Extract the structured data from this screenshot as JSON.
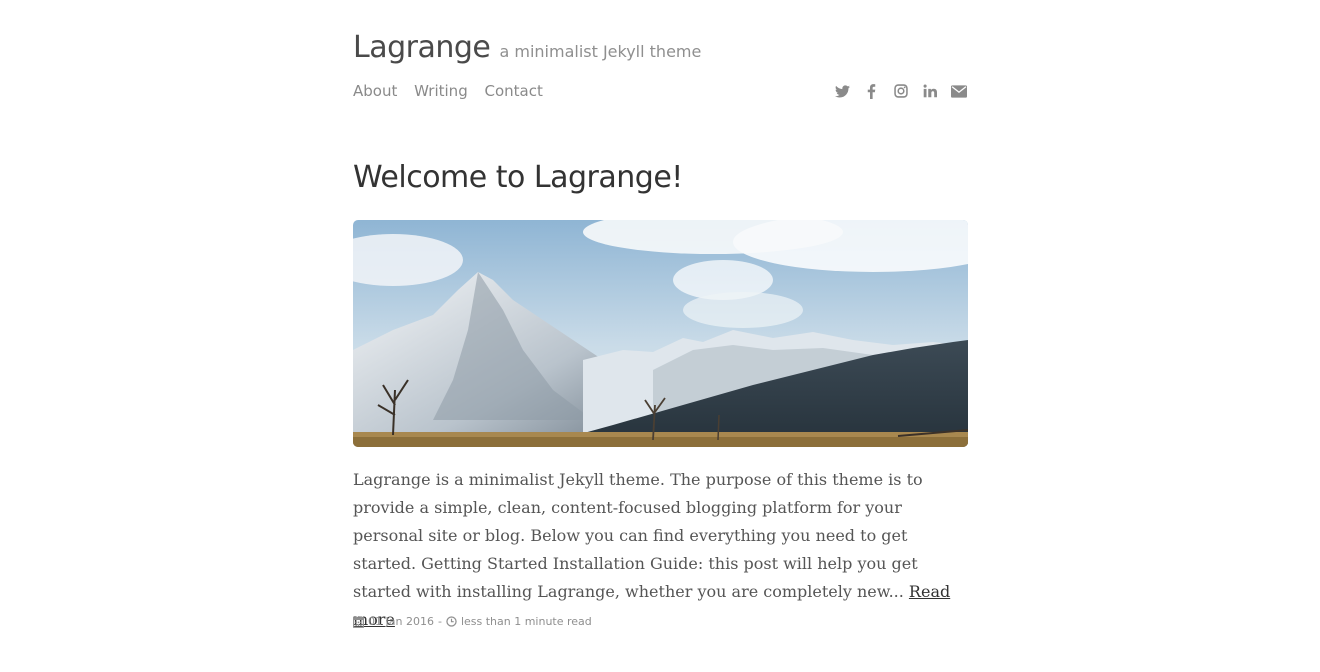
{
  "header": {
    "title": "Lagrange",
    "tagline": "a minimalist Jekyll theme",
    "nav": [
      {
        "label": "About"
      },
      {
        "label": "Writing"
      },
      {
        "label": "Contact"
      }
    ],
    "social_icons": [
      "twitter-icon",
      "facebook-icon",
      "instagram-icon",
      "linkedin-icon",
      "envelope-icon"
    ]
  },
  "post": {
    "title": "Welcome to Lagrange!",
    "image_alt": "snow-capped mountain landscape",
    "excerpt": "Lagrange is a minimalist Jekyll theme. The purpose of this theme is to provide a simple, clean, content-focused blogging platform for your personal site or blog. Below you can find everything you need to get started. Getting Started Installation Guide: this post will help you get started with installing Lagrange, whether you are completely new...",
    "read_more": "Read more",
    "date": "01 Jan 2016",
    "separator": "-",
    "reading_time": "less than 1 minute read"
  },
  "colors": {
    "text": "#333333",
    "muted": "#8a8a8a",
    "background": "#ffffff"
  }
}
